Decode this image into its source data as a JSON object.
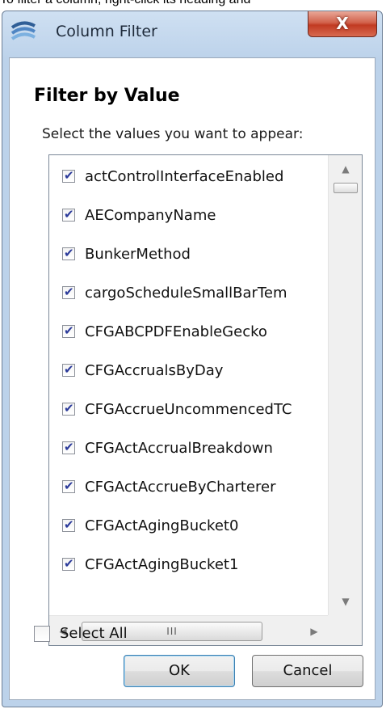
{
  "page_context": {
    "top_text": "To filter a column, right-click its heading and"
  },
  "window": {
    "title": "Column Filter",
    "close_label": "X"
  },
  "content": {
    "heading": "Filter by Value",
    "instruction": "Select the values you want to appear:",
    "items": [
      {
        "label": "actControlInterfaceEnabled",
        "checked": true
      },
      {
        "label": "AECompanyName",
        "checked": true
      },
      {
        "label": "BunkerMethod",
        "checked": true
      },
      {
        "label": "cargoScheduleSmallBarTem",
        "checked": true
      },
      {
        "label": "CFGABCPDFEnableGecko",
        "checked": true
      },
      {
        "label": "CFGAccrualsByDay",
        "checked": true
      },
      {
        "label": "CFGAccrueUncommencedTC",
        "checked": true
      },
      {
        "label": "CFGActAccrualBreakdown",
        "checked": true
      },
      {
        "label": "CFGActAccrueByCharterer",
        "checked": true
      },
      {
        "label": "CFGActAgingBucket0",
        "checked": true
      },
      {
        "label": "CFGActAgingBucket1",
        "checked": true
      }
    ],
    "scroll_icons": {
      "up": "scroll-up-arrow-icon",
      "down": "scroll-down-arrow-icon",
      "left": "scroll-left-arrow-icon",
      "right": "scroll-right-arrow-icon",
      "grip": "III"
    },
    "select_all": {
      "label": "Select All",
      "checked": false
    }
  },
  "buttons": {
    "ok": "OK",
    "cancel": "Cancel"
  },
  "colors": {
    "frame": "#bcd2ea",
    "close_button": "#c13a22",
    "check": "#2b3a9a"
  }
}
